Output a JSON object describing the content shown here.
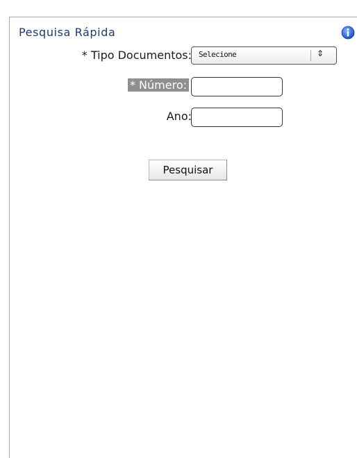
{
  "panel": {
    "title": "Pesquisa Rápida",
    "info_icon": "info-icon"
  },
  "form": {
    "tipo_label": "* Tipo Documentos:",
    "tipo_selected": "Selecione",
    "numero_label": "* Número:",
    "numero_value": "",
    "ano_label": "Ano:",
    "ano_value": "",
    "search_button_label": "Pesquisar"
  },
  "colors": {
    "title": "#1f3a6b",
    "panel_border": "#9aa9c4",
    "highlight_label_bg": "#8f8f8f",
    "info_icon": "#1a5bd6"
  }
}
